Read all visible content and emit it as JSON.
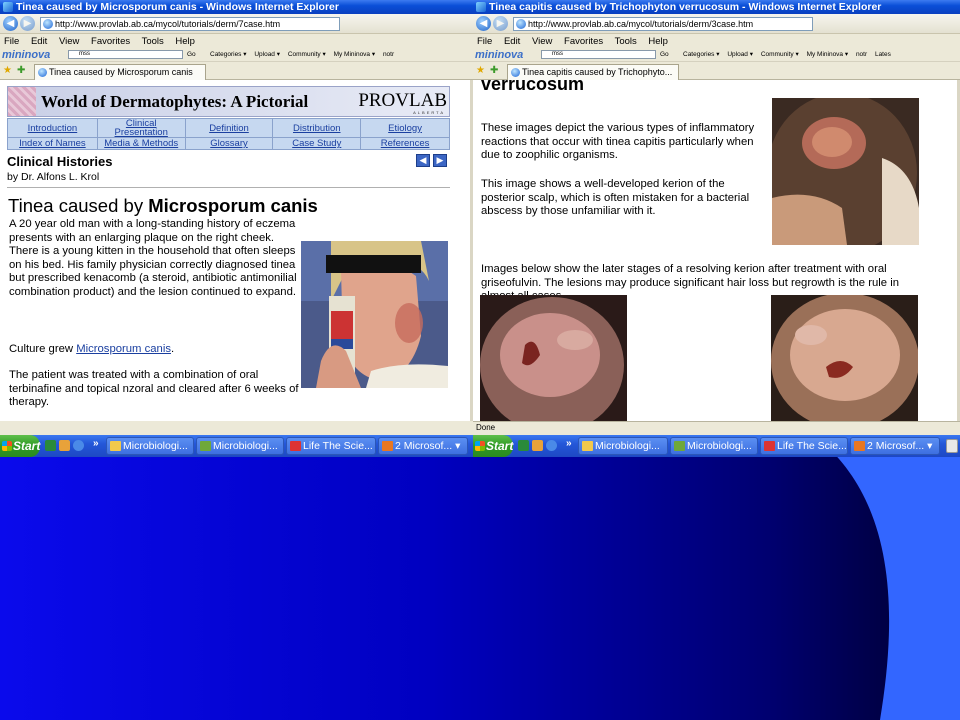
{
  "left_window": {
    "title": "Tinea caused by Microsporum canis - Windows Internet Explorer",
    "url": "http://www.provlab.ab.ca/mycol/tutorials/derm/7case.htm",
    "menu": [
      "File",
      "Edit",
      "View",
      "Favorites",
      "Tools",
      "Help"
    ],
    "toolbar_brand": "mininova",
    "toolbar_search": "mss",
    "toolbar_go": "Go",
    "toolbar_items": [
      "Categories ▾",
      "Upload ▾",
      "Community ▾",
      "My Mininova ▾",
      "notr"
    ],
    "tab_label": "Tinea caused by Microsporum canis",
    "page": {
      "banner_title": "World of Dermatophytes: A Pictorial",
      "banner_brand": "PROVLAB",
      "banner_brand_sub": "ALBERTA",
      "nav_row1": [
        "Introduction",
        "Clinical Presentation",
        "Definition",
        "Distribution",
        "Etiology"
      ],
      "nav_row2": [
        "Index of Names",
        "Media & Methods",
        "Glossary",
        "Case Study",
        "References"
      ],
      "section_heading": "Clinical Histories",
      "author": "by Dr. Alfons L. Krol",
      "case_title_prefix": "Tinea caused by ",
      "case_title_bold": "Microsporum canis",
      "para1": "A 20 year old man with a long-standing history of eczema presents with an enlarging plaque on the right cheek. There is a young kitten in the household that often sleeps on his bed. His family physician correctly diagnosed tinea but prescribed kenacomb (a steroid, antibiotic antimonilial combination product) and the lesion continued to expand.",
      "para2_prefix": "Culture grew ",
      "para2_link": "Microsporum canis",
      "para2_suffix": ".",
      "para3": "The patient was treated with a combination of oral terbinafine and topical nzoral and cleared after 6 weeks of therapy."
    }
  },
  "right_window": {
    "title": "Tinea capitis caused by Trichophyton verrucosum - Windows Internet Explorer",
    "url": "http://www.provlab.ab.ca/mycol/tutorials/derm/3case.htm",
    "menu": [
      "File",
      "Edit",
      "View",
      "Favorites",
      "Tools",
      "Help"
    ],
    "toolbar_brand": "mininova",
    "toolbar_search": "mss",
    "toolbar_go": "Go",
    "toolbar_items": [
      "Categories ▾",
      "Upload ▾",
      "Community ▾",
      "My Mininova ▾",
      "notr",
      "Lates"
    ],
    "tab_label": "Tinea capitis caused by Trichophyto...",
    "page": {
      "heading_fragment": "verrucosum",
      "para1": "These images depict the various types of inflammatory reactions that occur with tinea capitis particularly when due to zoophilic organisms.",
      "para2": "This image shows a well-developed kerion of the posterior scalp, which is often mistaken for a bacterial abscess by those unfamiliar with it.",
      "para3": "Images below show the later stages of a resolving kerion after treatment with oral griseofulvin. The lesions may produce significant hair loss but regrowth is the rule in almost all cases."
    },
    "status": "Done"
  },
  "taskbar_left": {
    "start": "Start",
    "chevron": "»",
    "buttons": [
      "Microbiologi...",
      "Microbiologi...",
      "Life The Scie...",
      "2 Microsof... ▾"
    ]
  },
  "taskbar_right": {
    "start": "Start",
    "chevron": "»",
    "buttons": [
      "Microbiologi...",
      "Microbiologi...",
      "Life The Scie...",
      "2 Microsof... ▾"
    ]
  },
  "colors": {
    "slide_blue": "#0000c8",
    "slide_swoosh": "#3366ff",
    "ie_titlebar": "#0a4fd8",
    "nav_cell": "#c6d8f0",
    "link": "#1a3fa0"
  }
}
